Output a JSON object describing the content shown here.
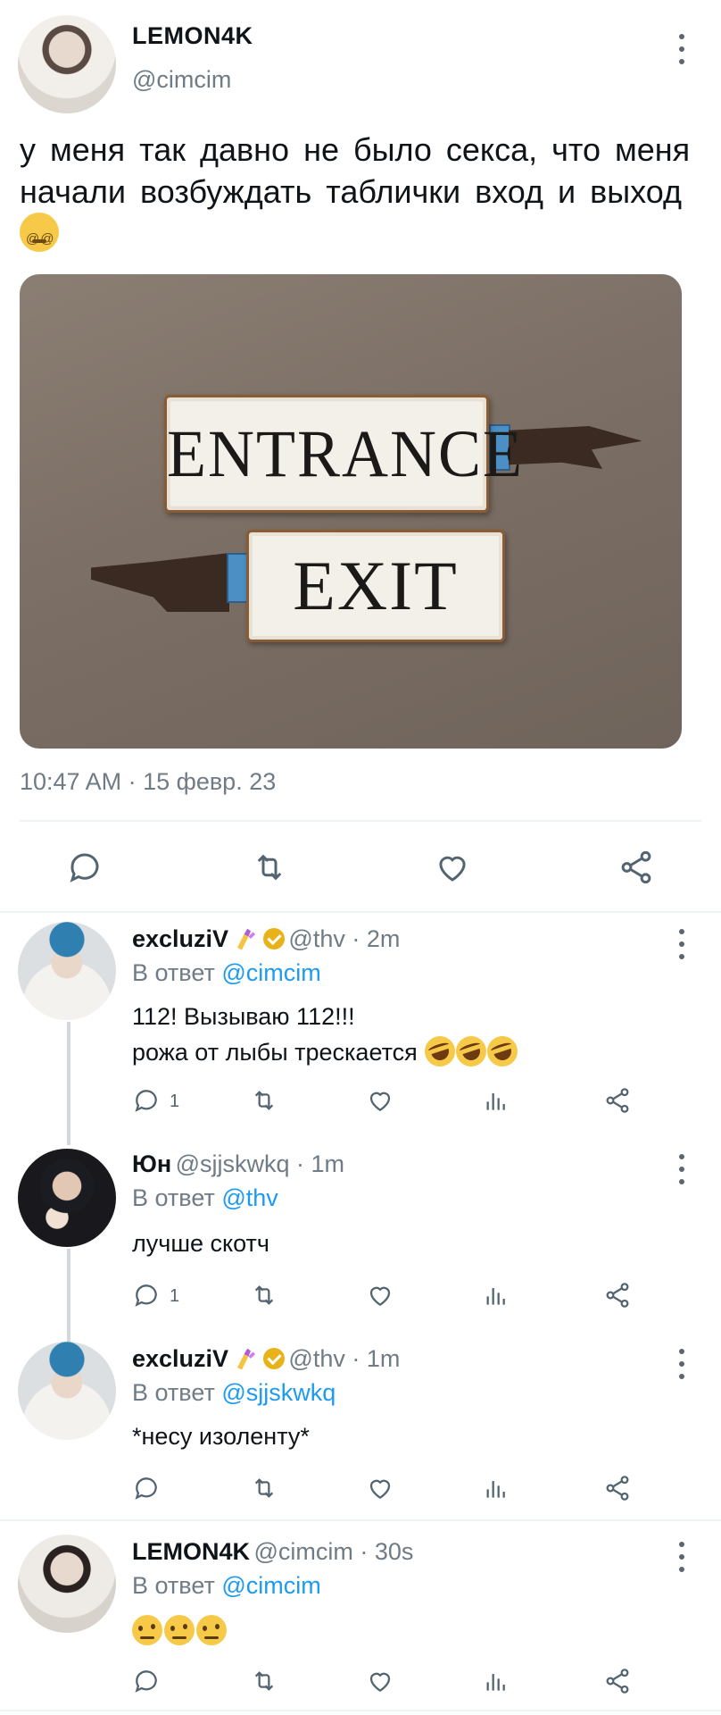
{
  "main_tweet": {
    "author_name": "LEMON4K",
    "author_handle": "@cimcim",
    "text": "у меня так давно не было секса,  что меня начали  возбуждать  таблички  вход и выход ",
    "text_emoji": "dizzy-face-emoji",
    "image": {
      "sign_top": "ENTRANCE",
      "sign_bottom": "EXIT"
    },
    "timestamp": "10:47 AM · 15 февр. 23",
    "actions": [
      "reply-icon",
      "retweet-icon",
      "like-icon",
      "share-icon"
    ]
  },
  "replies": [
    {
      "author_name": "excluziV",
      "badges": [
        "nail-polish-emoji",
        "verified-gold-badge"
      ],
      "meta": " @thv · 2m",
      "reply_label": "В ответ ",
      "reply_to": "@cimcim",
      "text_lines": [
        "112! Вызываю 112!!!",
        "рожа от лыбы трескается "
      ],
      "text_emoji": "rolling-laughing-emoji",
      "reply_count": "1"
    },
    {
      "author_name": "Юн",
      "meta": "  @sjjskwkq · 1m",
      "reply_label": "В ответ ",
      "reply_to": "@thv",
      "text_lines": [
        "лучше скотч"
      ],
      "reply_count": "1"
    },
    {
      "author_name": "excluziV",
      "badges": [
        "nail-polish-emoji",
        "verified-gold-badge"
      ],
      "meta": " @thv · 1m",
      "reply_label": "В ответ ",
      "reply_to": "@sjjskwkq",
      "text_lines": [
        "*несу изоленту*"
      ],
      "reply_count": ""
    },
    {
      "author_name": "LEMON4K",
      "meta": " @cimcim · 30s",
      "reply_label": "В ответ ",
      "reply_to": "@cimcim",
      "text_emoji": "face-with-raised-eyebrow-emoji",
      "reply_count": ""
    }
  ],
  "colors": {
    "link": "#1d9bf0",
    "secondary_text": "#6f7b85",
    "divider": "#eff3f4",
    "verified_badge": "#e8b31a"
  }
}
